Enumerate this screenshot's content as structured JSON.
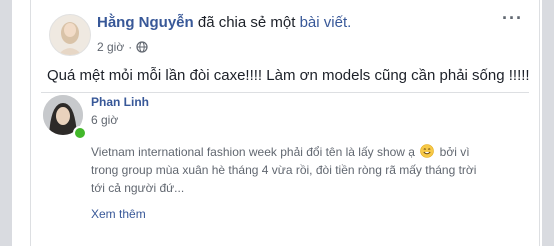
{
  "post": {
    "author": "Hằng Nguyễn",
    "share_text": "đã chia sẻ một",
    "share_link": "bài viết.",
    "time": "2 giờ",
    "privacy_icon": "globe-icon",
    "more_icon": "···",
    "text": "Quá mệt mỏi mỗi lần đòi caxe!!!! Làm ơn models cũng cần phải sống !!!!!"
  },
  "shared": {
    "author": "Phan Linh",
    "time": "6 giờ",
    "text_before_emoji": "Vietnam international fashion week phải đổi tên là lấy show ạ",
    "emoji": "smiling-face-emoji",
    "text_after_emoji": "bởi vì trong group mùa xuân hè tháng 4 vừa rồi, đòi tiền ròng rã mấy tháng trời tới cả người đứ...",
    "see_more": "Xem thêm"
  },
  "colors": {
    "link": "#385898",
    "text": "#1d2129",
    "secondary": "#616770",
    "online": "#42b72a",
    "border": "#dddfe2"
  }
}
